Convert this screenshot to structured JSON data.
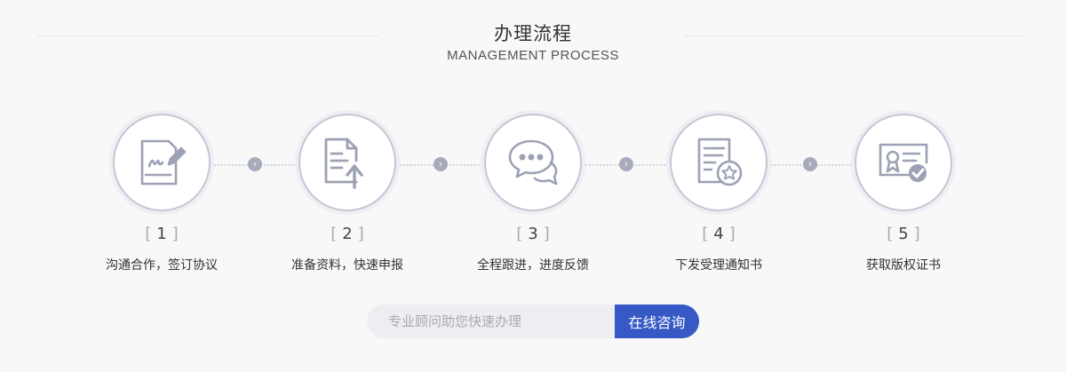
{
  "header": {
    "title": "办理流程",
    "subtitle": "MANAGEMENT PROCESS"
  },
  "steps": [
    {
      "number": "1",
      "label": "沟通合作，签订协议",
      "icon": "signature-document-icon"
    },
    {
      "number": "2",
      "label": "准备资料，快速申报",
      "icon": "document-upload-icon"
    },
    {
      "number": "3",
      "label": "全程跟进，进度反馈",
      "icon": "chat-bubbles-icon"
    },
    {
      "number": "4",
      "label": "下发受理通知书",
      "icon": "notice-star-icon"
    },
    {
      "number": "5",
      "label": "获取版权证书",
      "icon": "certificate-icon"
    }
  ],
  "bracket_open": "[",
  "bracket_close": "]",
  "arrow_glyph": "›",
  "consult": {
    "placeholder": "专业顾问助您快速办理",
    "button_label": "在线咨询"
  },
  "colors": {
    "accent": "#3759c6",
    "icon_stroke": "#9ca1b4",
    "ring": "#c3c7d3"
  }
}
